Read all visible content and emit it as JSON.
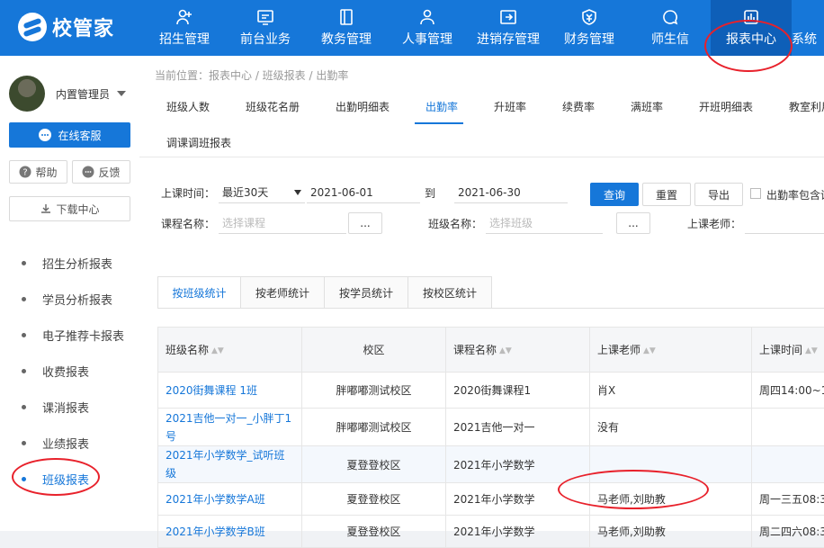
{
  "brand": {
    "name": "校管家"
  },
  "nav": [
    {
      "label": "招生管理",
      "icon": "user-add-icon"
    },
    {
      "label": "前台业务",
      "icon": "monitor-icon"
    },
    {
      "label": "教务管理",
      "icon": "book-icon"
    },
    {
      "label": "人事管理",
      "icon": "user-icon"
    },
    {
      "label": "进销存管理",
      "icon": "login-box-icon"
    },
    {
      "label": "财务管理",
      "icon": "money-shield-icon"
    },
    {
      "label": "师生信",
      "icon": "chat-icon"
    },
    {
      "label": "报表中心",
      "icon": "chart-icon",
      "active": true
    },
    {
      "label": "系统",
      "icon": ""
    }
  ],
  "sidebar": {
    "user_name": "内置管理员",
    "service_label": "在线客服",
    "help_label": "帮助",
    "feedback_label": "反馈",
    "download_label": "下载中心",
    "items": [
      {
        "label": "招生分析报表"
      },
      {
        "label": "学员分析报表"
      },
      {
        "label": "电子推荐卡报表"
      },
      {
        "label": "收费报表"
      },
      {
        "label": "课消报表"
      },
      {
        "label": "业绩报表"
      },
      {
        "label": "班级报表",
        "active": true
      }
    ]
  },
  "breadcrumb": "当前位置：报表中心 / 班级报表 / 出勤率",
  "subtabs": [
    "班级人数",
    "班级花名册",
    "出勤明细表",
    "出勤率",
    "升班率",
    "续费率",
    "满班率",
    "开班明细表",
    "教室利用",
    "调课调班报表"
  ],
  "filters": {
    "time_label": "上课时间：",
    "time_range": "最近30天",
    "date_from": "2021-06-01",
    "to_label": "到",
    "date_to": "2021-06-30",
    "query_label": "查询",
    "reset_label": "重置",
    "export_label": "导出",
    "checkbox_label": "出勤率包含试",
    "course_label": "课程名称：",
    "course_placeholder": "选择课程",
    "class_label": "班级名称：",
    "class_placeholder": "选择班级",
    "teacher_label": "上课老师：",
    "ellipsis": "..."
  },
  "stat_tabs": [
    "按班级统计",
    "按老师统计",
    "按学员统计",
    "按校区统计"
  ],
  "table": {
    "headers": [
      "班级名称",
      "校区",
      "课程名称",
      "上课老师",
      "上课时间"
    ],
    "rows": [
      {
        "name": "2020街舞课程 1班",
        "campus": "胖嘟嘟测试校区",
        "course": "2020街舞课程1",
        "teacher": "肖X",
        "time": "周四14:00~1"
      },
      {
        "name": "2021吉他一对一_小胖丁1号",
        "campus": "胖嘟嘟测试校区",
        "course": "2021吉他一对一",
        "teacher": "没有",
        "time": ""
      },
      {
        "name": "2021年小学数学_试听班级",
        "campus": "夏登登校区",
        "course": "2021年小学数学",
        "teacher": "",
        "time": ""
      },
      {
        "name": "2021年小学数学A班",
        "campus": "夏登登校区",
        "course": "2021年小学数学",
        "teacher": "马老师,刘助教",
        "time": "周一三五08:3"
      },
      {
        "name": "2021年小学数学B班",
        "campus": "夏登登校区",
        "course": "2021年小学数学",
        "teacher": "马老师,刘助教",
        "time": "周二四六08:3"
      }
    ]
  },
  "colors": {
    "primary": "#1677d9",
    "annotation": "#e8212b"
  }
}
